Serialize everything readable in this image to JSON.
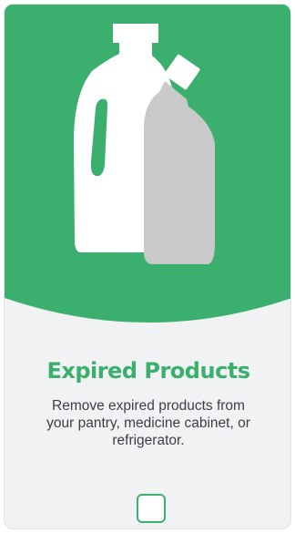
{
  "card": {
    "title": "Expired Products",
    "description": "Remove expired products from your pantry, medicine cabinet, or refrigerator.",
    "checkbox_checked": false,
    "illustration_icons": [
      "jug-bottle-icon",
      "cleaner-bottle-icon"
    ]
  },
  "colors": {
    "accent": "#3aaf6e",
    "card_background": "#f1f2f3",
    "text": "#3b3f44",
    "jug": "#ffffff",
    "bottle": "#c9c9c9"
  }
}
